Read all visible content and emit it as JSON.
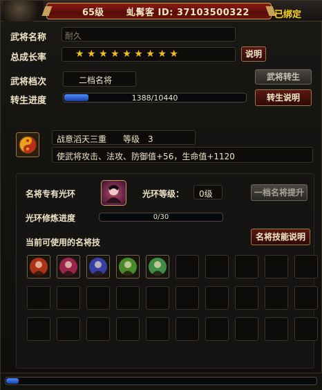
{
  "header": {
    "level": "65级",
    "name_id": "虬髯客 ID: 37103500322",
    "bound": "已绑定"
  },
  "general": {
    "name_label": "武将名称",
    "name_value": "耐久",
    "growth_label": "总成长率",
    "stars": "★★★★★★★★★",
    "explain_button": "说明",
    "tier_label": "武将档次",
    "tier_value": "二档名将",
    "reincarnate_button": "武将转生",
    "progress_label": "转生进度",
    "progress_text": "1388/10440",
    "progress_value": 1388,
    "progress_max": 10440,
    "reincarnate_explain_button": "转生说明"
  },
  "skill": {
    "icon": "yin-yang-icon",
    "name_level": "战意滔天三重　　等级　3",
    "effect": "使武将攻击、法攻、防御值+56，生命值+1120"
  },
  "aura": {
    "exclusive_label": "名将专有光环",
    "aura_icon": "aura-portrait-icon",
    "aura_level_label": "光环等级：",
    "aura_level_value": "0级",
    "upgrade_button": "一档名将提升",
    "train_label": "光环修炼进度",
    "train_text": "0/30",
    "train_value": 0,
    "train_max": 30,
    "usable_label": "当前可使用的名将技",
    "skill_explain_button": "名将技能说明",
    "skills": [
      {
        "icon": "fire-warrior-icon",
        "color": "#c8381a"
      },
      {
        "icon": "crimson-wings-icon",
        "color": "#b02858"
      },
      {
        "icon": "blue-vortex-icon",
        "color": "#3c48c0"
      },
      {
        "icon": "green-blade-icon",
        "color": "#50a030"
      },
      {
        "icon": "green-gourd-icon",
        "color": "#48a050"
      }
    ]
  },
  "colors": {
    "accent_red": "#5a1812",
    "progress_blue": "#4c8cff",
    "star_gold": "#f1c020",
    "bound_yellow": "#ffd21e"
  }
}
